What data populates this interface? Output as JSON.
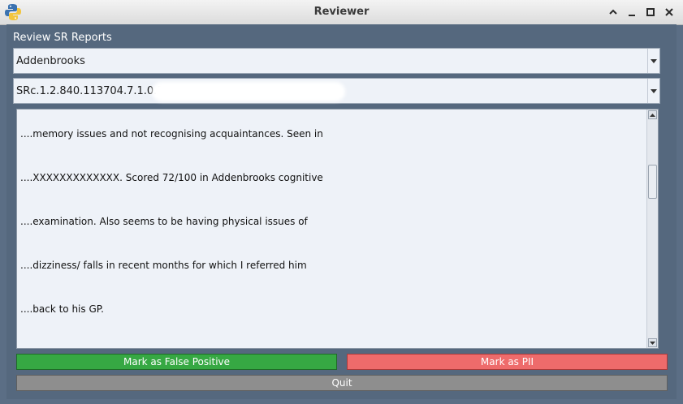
{
  "window": {
    "title": "Reviewer"
  },
  "main": {
    "section_label": "Review SR Reports",
    "site_select_value": "Addenbrooks",
    "report_select_value": "SRc.1.2.840.113704.7.1.0.2",
    "report_lines": [
      "....memory issues and not recognising acquaintances. Seen in",
      "....XXXXXXXXXXXXX. Scored 72/100 in Addenbrooks cognitive",
      "....examination. Also seems to be having physical issues of",
      "....dizziness/ falls in recent months for which I referred him",
      "....back to his GP."
    ]
  },
  "buttons": {
    "false_positive": "Mark as False Positive",
    "pii": "Mark as PII",
    "quit": "Quit"
  },
  "colors": {
    "false_positive_bg": "#36a843",
    "pii_bg": "#ee6b6b",
    "quit_bg": "#8e8e8e",
    "window_bg": "#5b6e85"
  },
  "icons": {
    "app": "python-logo-icon",
    "controls": [
      "keep-above-icon",
      "minimize-icon",
      "maximize-icon",
      "close-icon"
    ]
  }
}
